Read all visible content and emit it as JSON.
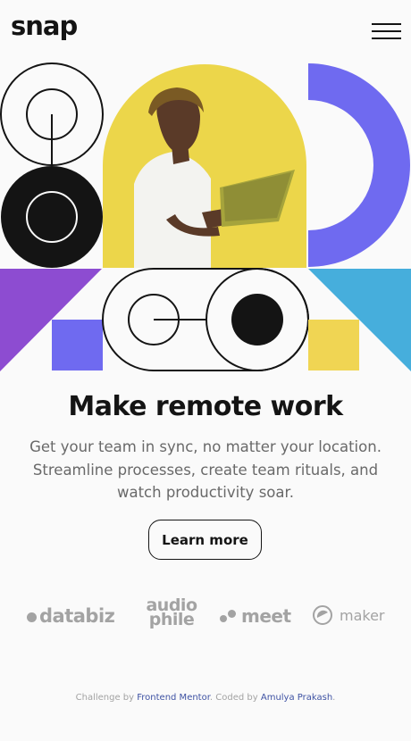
{
  "header": {
    "logo": "snap",
    "menu_icon": "hamburger-menu-icon"
  },
  "hero": {
    "colors": {
      "yellow": "#ecd64a",
      "purple": "#6f6af0",
      "violet": "#8d4cd1",
      "cyan": "#46aedc",
      "gold": "#f0d553",
      "black": "#141414"
    }
  },
  "main": {
    "headline": "Make remote work",
    "subtext": "Get your team in sync, no matter your location. Streamline processes, create team rituals, and watch productivity soar.",
    "cta_label": "Learn more"
  },
  "clients": {
    "databiz": "databiz",
    "databiz_mark": "·",
    "audio_line1": "audio",
    "audio_line2": "phile",
    "meet": "meet",
    "meet_mark": "·",
    "maker": "maker"
  },
  "footer": {
    "prefix": "Challenge by ",
    "link1": "Frontend Mentor",
    "middle": ". Coded by ",
    "link2": "Amulya Prakash",
    "suffix": "."
  }
}
